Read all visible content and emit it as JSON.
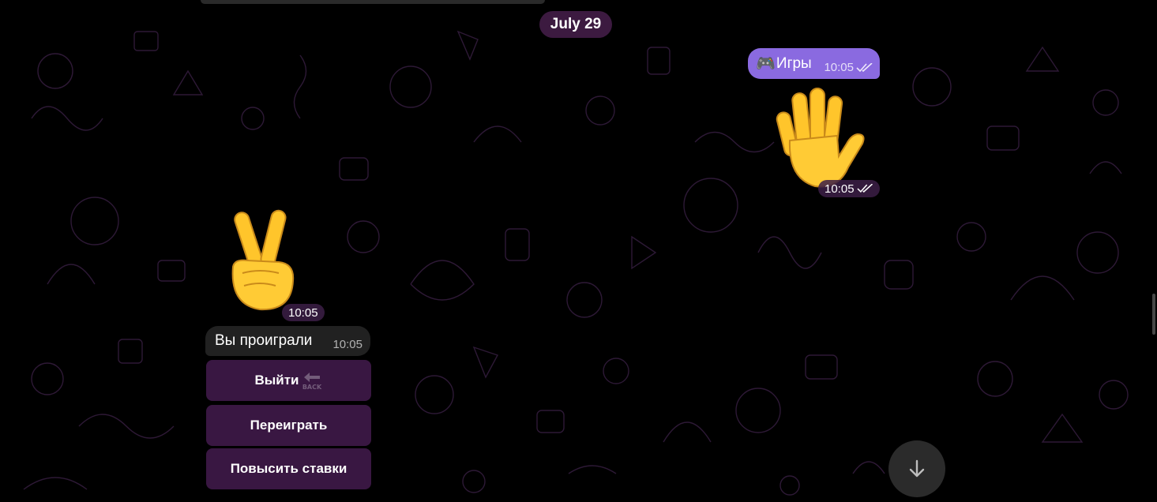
{
  "date_separator": "July 29",
  "messages": {
    "outgoing_text": {
      "icon": "gamepad-icon",
      "emoji": "🎮",
      "text": "Игры",
      "time": "10:05",
      "status": "read"
    },
    "outgoing_sticker": {
      "icon": "raised-hand-sticker",
      "time": "10:05",
      "status": "read"
    },
    "incoming_sticker": {
      "icon": "victory-hand-sticker",
      "time": "10:05"
    },
    "incoming_text": {
      "text": "Вы проиграли",
      "time": "10:05"
    }
  },
  "inline_keyboard": [
    {
      "label": "Выйти",
      "icon": "back-arrow-icon",
      "icon_text": "BACK"
    },
    {
      "label": "Переиграть"
    },
    {
      "label": "Повысить ставки"
    }
  ],
  "colors": {
    "background": "#000000",
    "outgoing_bubble": "#8a6ae0",
    "incoming_bubble": "#212121",
    "keyboard_button": "#3e1948",
    "pattern_stroke": "#4a2a55"
  }
}
